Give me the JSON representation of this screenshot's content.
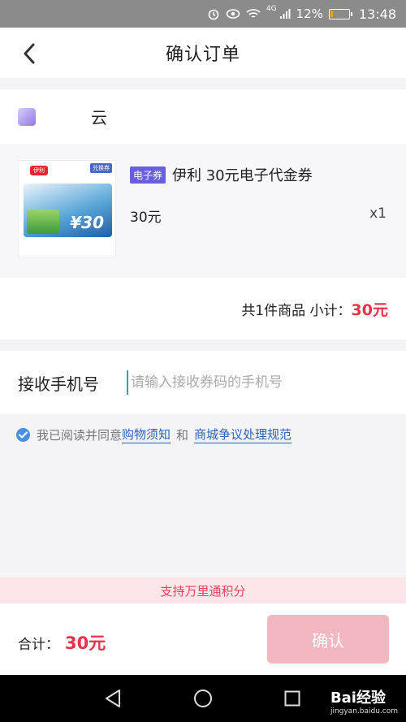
{
  "status": {
    "battery_text": "12%",
    "battery_level": 0.12,
    "network": "4G",
    "time": "13:48",
    "icons": [
      "alarm-icon",
      "eye-icon",
      "wifi-icon",
      "signal-icon",
      "battery-icon"
    ]
  },
  "header": {
    "title": "确认订单",
    "back_icon": "chevron-left-icon"
  },
  "shop": {
    "name": "   云"
  },
  "product": {
    "badge": "电子券",
    "title": "伊利 30元电子代金券",
    "price": "30元",
    "quantity": "x1",
    "thumb": {
      "logo": "伊利",
      "tag": "兑换券",
      "value": "¥30"
    }
  },
  "subtotal": {
    "label": "共1件商品 小计：",
    "amount": "30元"
  },
  "phone": {
    "label": "接收手机号",
    "placeholder": "请输入接收券码的手机号",
    "value": ""
  },
  "agreement": {
    "prefix": "我已阅读并同意",
    "link1": "购物须知",
    "conj": "和",
    "link2": "商城争议处理规范",
    "checked": true
  },
  "support_banner": "支持万里通积分",
  "footer": {
    "total_label": "合计：",
    "total_amount": "30元",
    "confirm_label": "确认"
  },
  "system_nav": {
    "watermark": "Bai经验",
    "watermark_sub": "jingyan.baidu.com"
  },
  "colors": {
    "accent": "#e8334a",
    "link": "#2b63b8",
    "badge": "#6a5ee0",
    "button": "#f3b7c1",
    "banner": "#fde6ea"
  }
}
